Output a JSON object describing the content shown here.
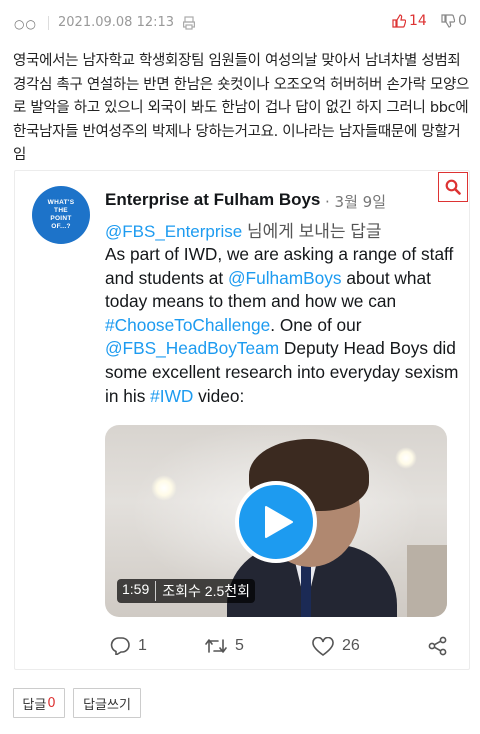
{
  "header": {
    "menu_dots": "○○",
    "date": "2021.09.08 12:13",
    "upvotes": "14",
    "downvotes": "0"
  },
  "post": {
    "text": "영국에서는 남자학교 학생회장팀 임원들이 여성의날 맞아서 남녀차별 성범죄 경각심 촉구 연설하는 반면 한남은 숏컷이나 오조오억 허버허버 손가락 모양으로 발악을 하고 있으니 외국이 봐도 한남이 겁나 답이 없긴 하지 그러니 bbc에 한국남자들 반여성주의 박제나 당하는거고요. 이나라는 남자들때문에 망할거임"
  },
  "tweet": {
    "avatar_text": [
      "WHAT'S",
      "THE",
      "POINT",
      "OF...?"
    ],
    "author": "Enterprise at Fulham Boys",
    "date": "· 3월 9일",
    "reply_handle": "@FBS_Enterprise",
    "reply_suffix": " 님에게 보내는 답글",
    "body_1": "As part of IWD, we are asking a range of staff and students at ",
    "mention_1": "@FulhamBoys",
    "body_2": " about what today means to them and how we can ",
    "hashtag_1": "#ChooseToChallenge",
    "body_3": ". One of our ",
    "mention_2": "@FBS_HeadBoyTeam",
    "body_4": " Deputy Head Boys did some excellent research into everyday sexism in his ",
    "hashtag_2": "#IWD",
    "body_5": " video:",
    "video_duration": "1:59",
    "video_views": "조회수 2.5천회",
    "reply_count": "1",
    "retweet_count": "5",
    "like_count": "26",
    "link_color": "#1d9bf0"
  },
  "footer": {
    "comments_label": "답글",
    "comments_count": "0",
    "write_label": "답글쓰기"
  }
}
